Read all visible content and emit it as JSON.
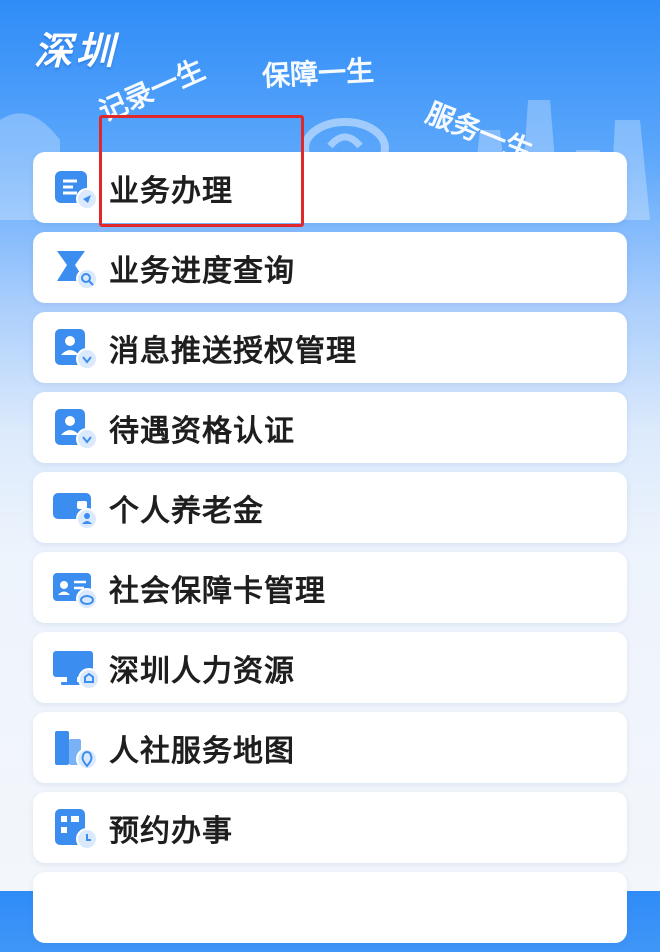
{
  "header": {
    "city": "深圳",
    "slogans": [
      "记录一生",
      "保障一生",
      "服务一生"
    ]
  },
  "menu": {
    "items": [
      {
        "label": "业务办理",
        "icon": "business-handling-icon"
      },
      {
        "label": "业务进度查询",
        "icon": "progress-query-icon"
      },
      {
        "label": "消息推送授权管理",
        "icon": "message-auth-icon"
      },
      {
        "label": "待遇资格认证",
        "icon": "qualification-cert-icon"
      },
      {
        "label": "个人养老金",
        "icon": "pension-card-icon"
      },
      {
        "label": "社会保障卡管理",
        "icon": "social-security-card-icon"
      },
      {
        "label": "深圳人力资源",
        "icon": "computer-icon"
      },
      {
        "label": "人社服务地图",
        "icon": "map-building-icon"
      },
      {
        "label": "预约办事",
        "icon": "appointment-icon"
      }
    ]
  },
  "colors": {
    "accent": "#3b8df0",
    "highlight": "#e0272a"
  }
}
